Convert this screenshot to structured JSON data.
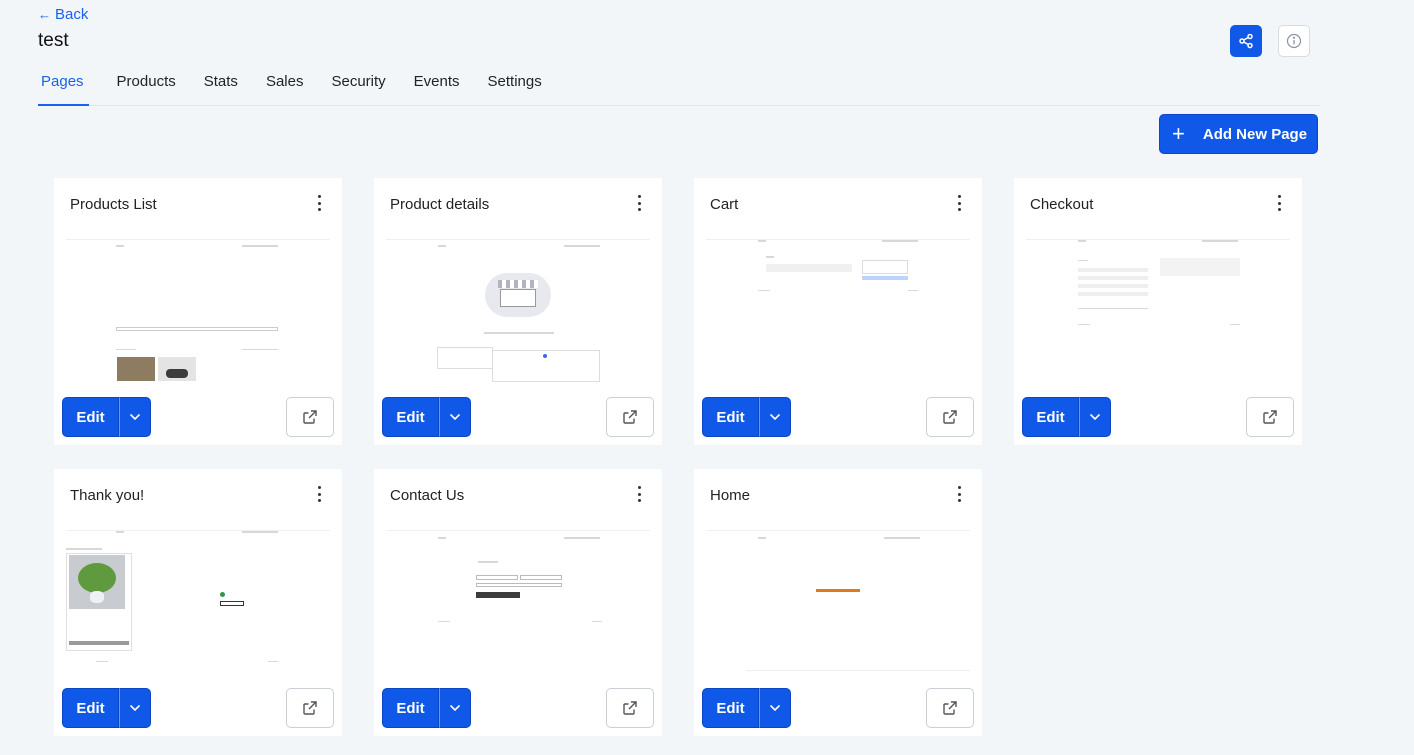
{
  "header": {
    "back_label": "Back",
    "title": "test",
    "share_icon": "share-icon",
    "info_icon": "info-icon"
  },
  "tabs": [
    {
      "label": "Pages",
      "active": true
    },
    {
      "label": "Products"
    },
    {
      "label": "Stats"
    },
    {
      "label": "Sales"
    },
    {
      "label": "Security"
    },
    {
      "label": "Events"
    },
    {
      "label": "Settings"
    }
  ],
  "actions": {
    "add_new_page_label": "Add New Page"
  },
  "pages": [
    {
      "title": "Products List",
      "edit_label": "Edit"
    },
    {
      "title": "Product details",
      "edit_label": "Edit"
    },
    {
      "title": "Cart",
      "edit_label": "Edit"
    },
    {
      "title": "Checkout",
      "edit_label": "Edit"
    },
    {
      "title": "Thank you!",
      "edit_label": "Edit"
    },
    {
      "title": "Contact Us",
      "edit_label": "Edit"
    },
    {
      "title": "Home",
      "edit_label": "Edit"
    }
  ],
  "colors": {
    "accent": "#1058e8",
    "background": "#f2f6f9",
    "home_preview_text": "#e07a1c"
  }
}
